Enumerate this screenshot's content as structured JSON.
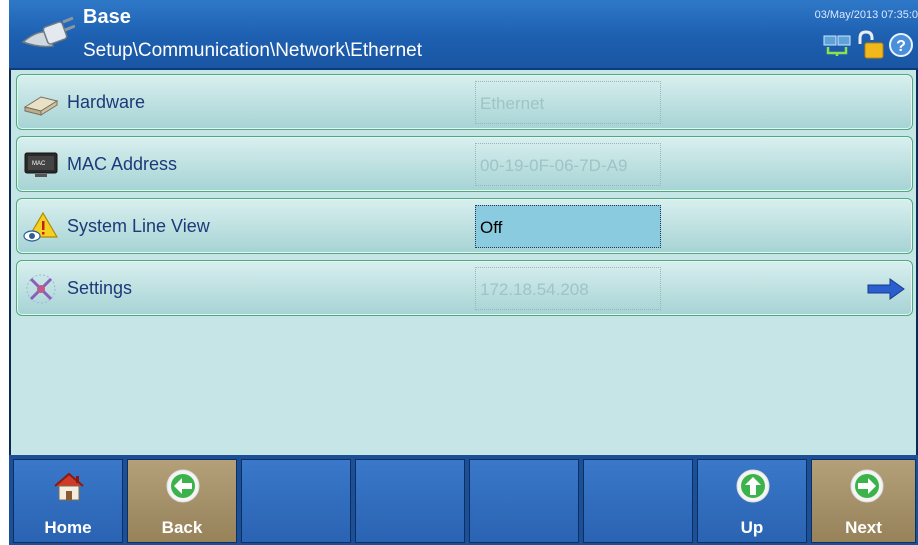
{
  "header": {
    "title": "Base",
    "path": "Setup\\Communication\\Network\\Ethernet",
    "datetime": "03/May/2013 07:35:0",
    "icons": [
      "plug-icon",
      "network-status-icon",
      "unlock-icon",
      "help-icon"
    ]
  },
  "rows": [
    {
      "label": "Hardware",
      "value": "Ethernet",
      "icon": "network-card-icon"
    },
    {
      "label": "MAC Address",
      "value": "00-19-0F-06-7D-A9",
      "icon": "monitor-icon"
    },
    {
      "label": "System Line View",
      "value": "Off",
      "icon": "warning-eye-icon"
    },
    {
      "label": "Settings",
      "value": "172.18.54.208",
      "icon": "network-settings-icon",
      "arrow": "right-arrow-icon"
    }
  ],
  "softkeys": [
    {
      "label": "Home",
      "icon": "home-icon"
    },
    {
      "label": "Back",
      "icon": "back-arrow-icon"
    },
    {
      "label": ""
    },
    {
      "label": ""
    },
    {
      "label": ""
    },
    {
      "label": ""
    },
    {
      "label": "Up",
      "icon": "up-arrow-icon"
    },
    {
      "label": "Next",
      "icon": "next-arrow-icon"
    }
  ],
  "colors": {
    "header": "#1d5fb0",
    "content_bg": "#c6e5e6",
    "softkey_blue": "#2a63b2",
    "softkey_brown": "#97825a",
    "active_field": "#8bcbe0",
    "label_text": "#1d3a78"
  }
}
